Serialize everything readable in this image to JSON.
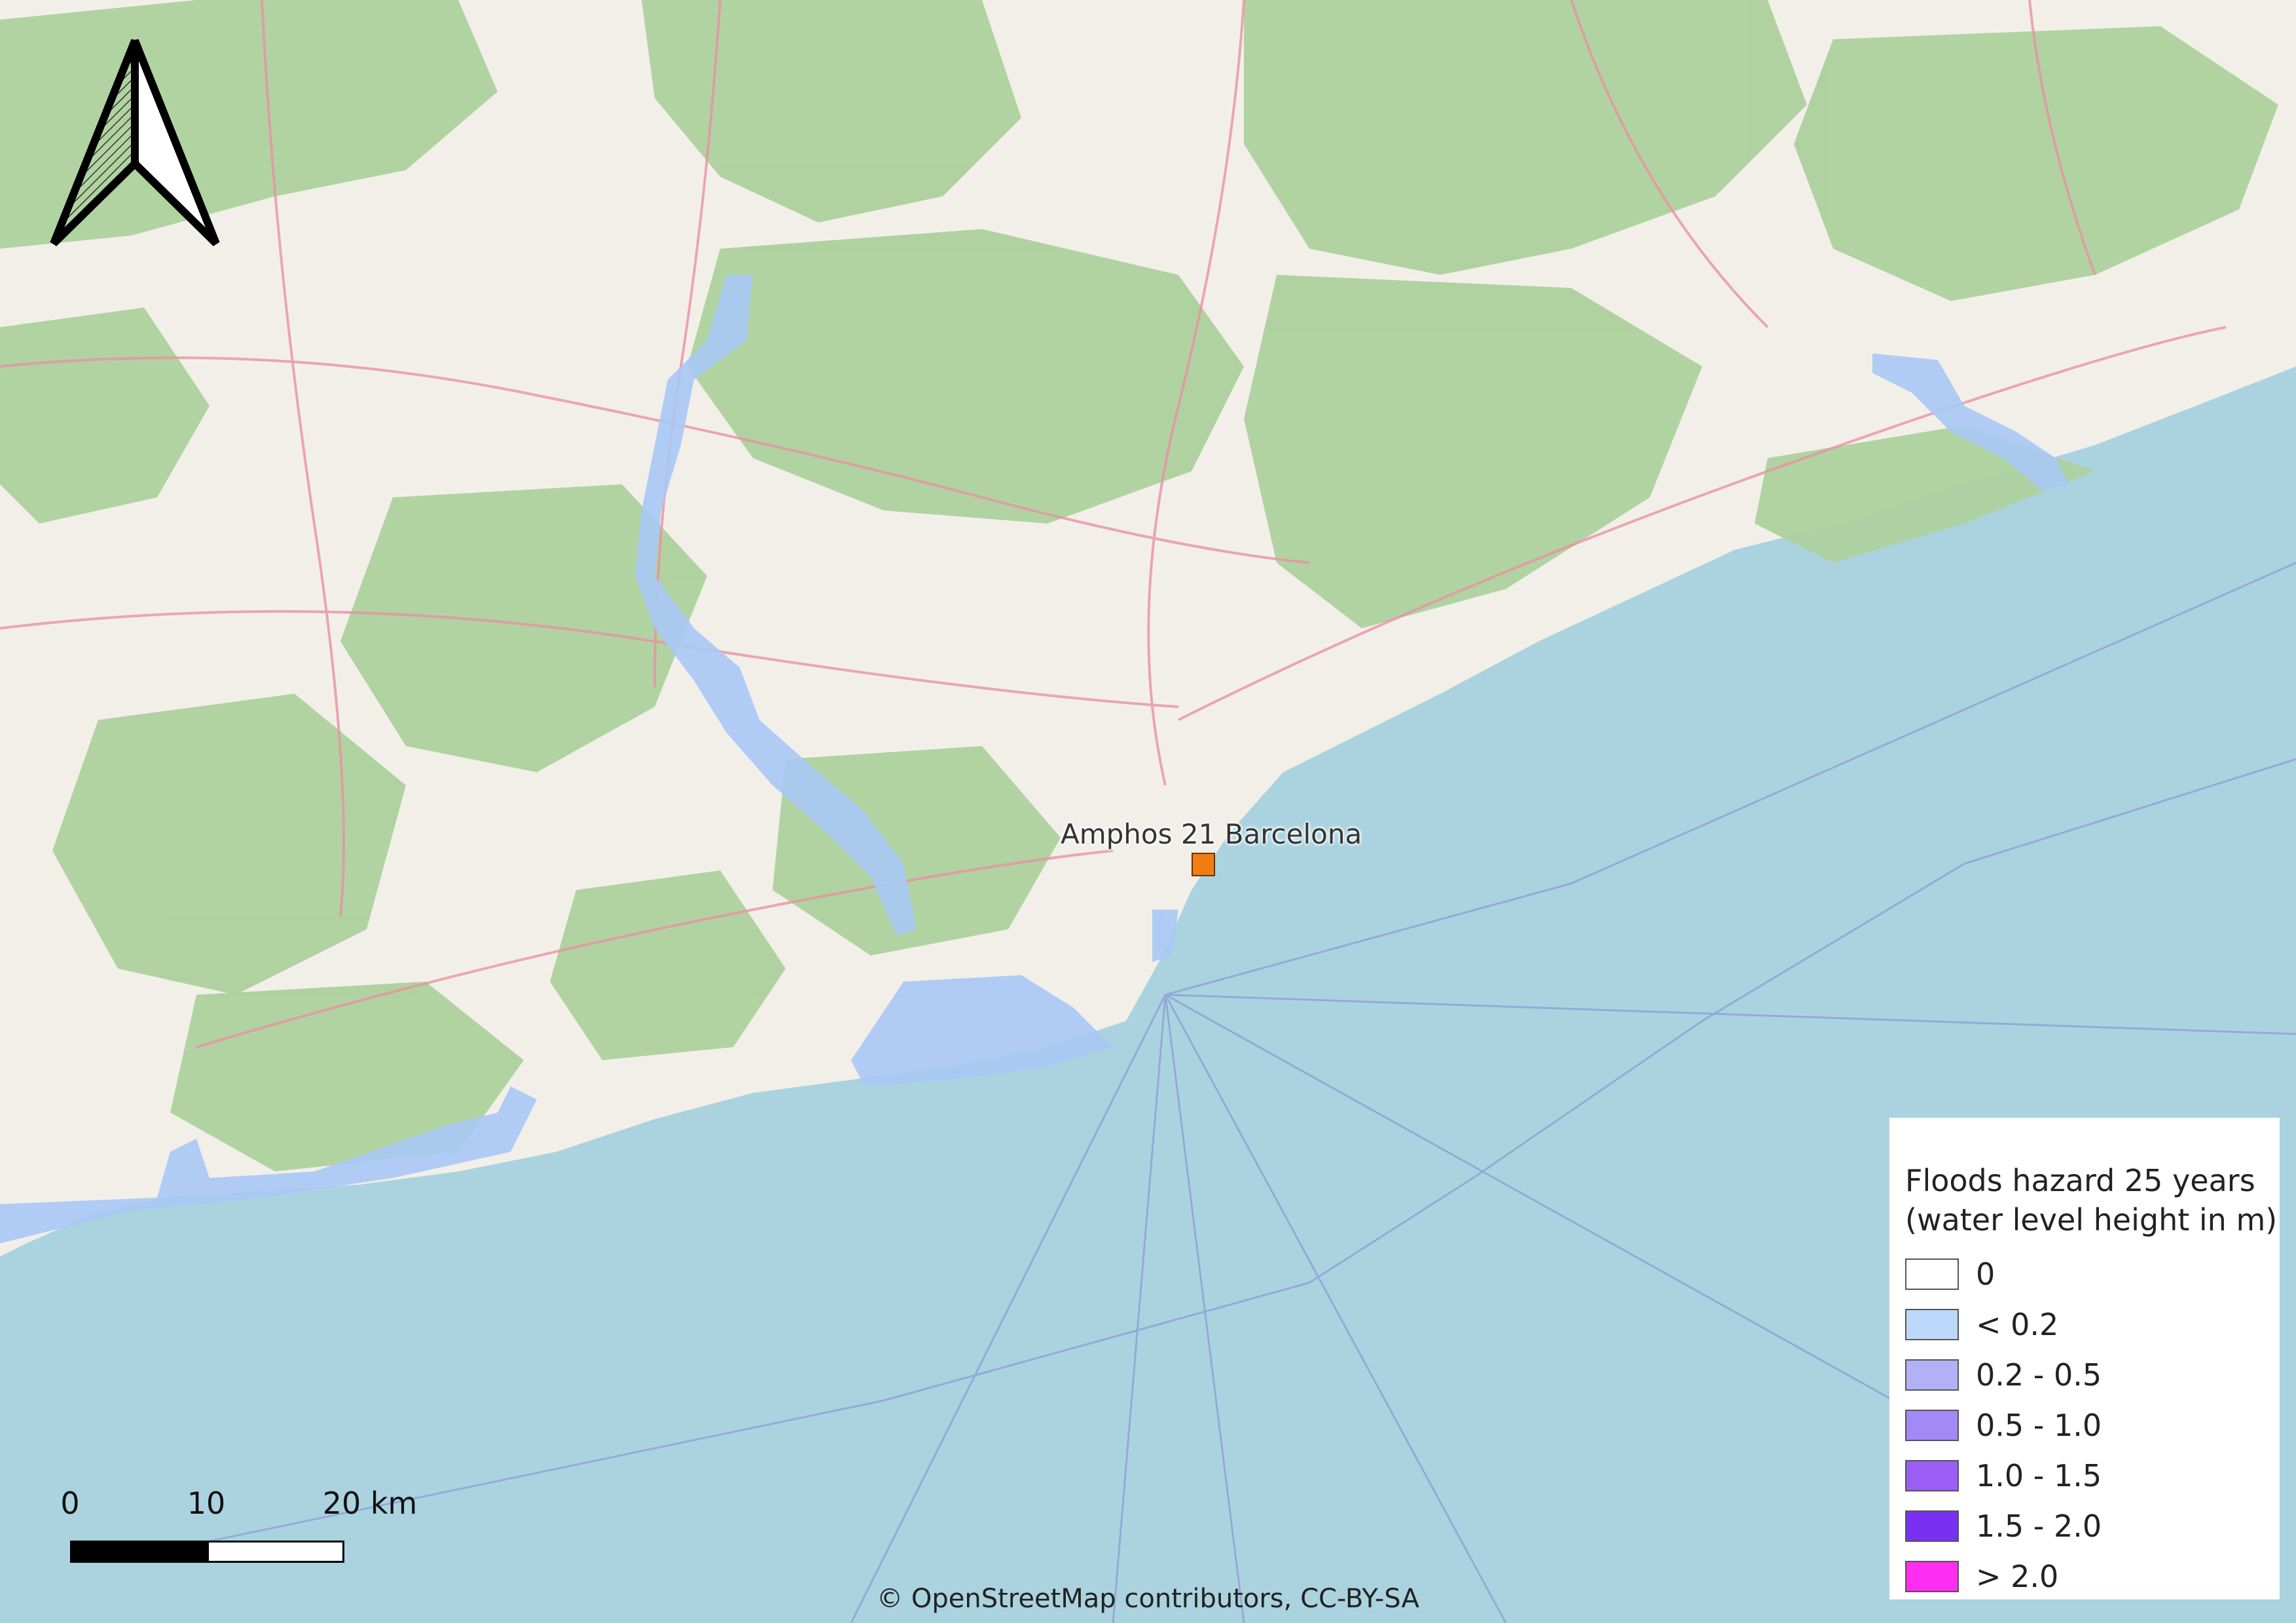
{
  "legend": {
    "title_line1": "Floods hazard 25 years",
    "title_line2": "(water level height in m)",
    "items": [
      {
        "label": "0",
        "color": "#ffffff"
      },
      {
        "label": "< 0.2",
        "color": "#bcd8fb"
      },
      {
        "label": "0.2 - 0.5",
        "color": "#b3b1f6"
      },
      {
        "label": "0.5 - 1.0",
        "color": "#a389f5"
      },
      {
        "label": "1.0 - 1.5",
        "color": "#9b5ef4"
      },
      {
        "label": "1.5 - 2.0",
        "color": "#7a30f3"
      },
      {
        "label": "> 2.0",
        "color": "#ff2cf2"
      }
    ]
  },
  "scale_bar": {
    "labels": [
      "0",
      "10",
      "20 km"
    ]
  },
  "place": {
    "label": "Amphos 21 Barcelona",
    "marker_color": "#f07d12"
  },
  "attribution": "© OpenStreetMap contributors, CC-BY-SA",
  "north_arrow": {
    "icon": "north-arrow-icon"
  },
  "colors": {
    "sea": "#aad3df",
    "land": "#f2efe9",
    "forest": "#add19e",
    "road": "#e892a2",
    "flood": "#a9c8f5"
  }
}
